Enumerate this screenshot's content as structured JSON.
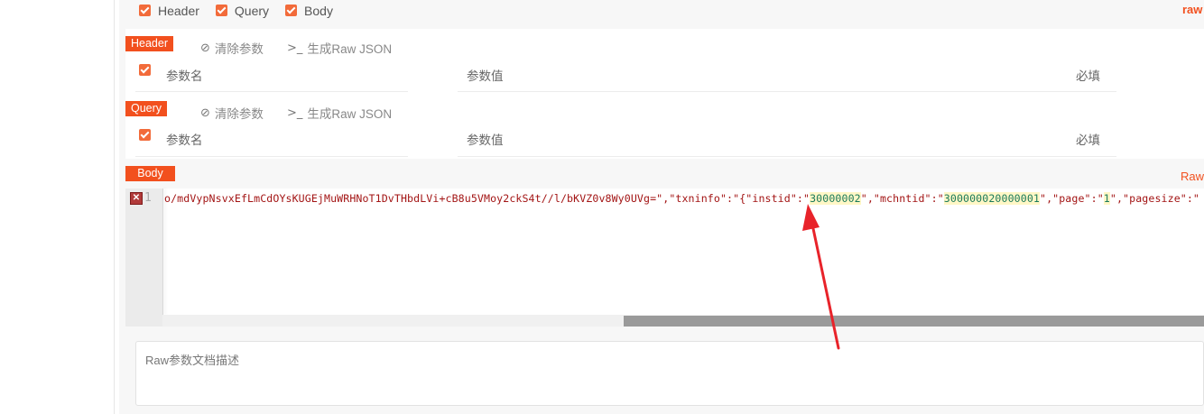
{
  "options": {
    "header_label": "Header",
    "query_label": "Query",
    "body_label": "Body",
    "raw_link": "raw"
  },
  "header_section": {
    "tag": "Header",
    "clear_label": "清除参数",
    "gen_label": "生成Raw JSON",
    "col_name": "参数名",
    "col_value": "参数值",
    "col_required": "必填"
  },
  "query_section": {
    "tag": "Query",
    "clear_label": "清除参数",
    "gen_label": "生成Raw JSON",
    "col_name": "参数名",
    "col_value": "参数值",
    "col_required": "必填"
  },
  "body_section": {
    "tag": "Body",
    "raw_label": "Raw"
  },
  "editor": {
    "line_number": "1",
    "error_icon": "x-icon",
    "code_part1": "o/mdVypNsvxEfLmCdOYsKUGEjMuWRHNoT1DvTHbdLVi+cB8u5VMoy2ckS4t//l/bKVZ0v8Wy0UVg=\",\"txninfo\":\"{\"instid\":\"",
    "code_value1": "30000002",
    "code_part2": "\",\"mchntid\":\"",
    "code_value2": "300000020000001",
    "code_part3": "\",\"page\":\"",
    "code_value3": "1",
    "code_part4": "\",\"pagesize\":\""
  },
  "description": {
    "placeholder": "Raw参数文档描述"
  },
  "colors": {
    "accent": "#f2501e",
    "checkbox": "#f26b3a",
    "arrow": "#e8232a"
  }
}
